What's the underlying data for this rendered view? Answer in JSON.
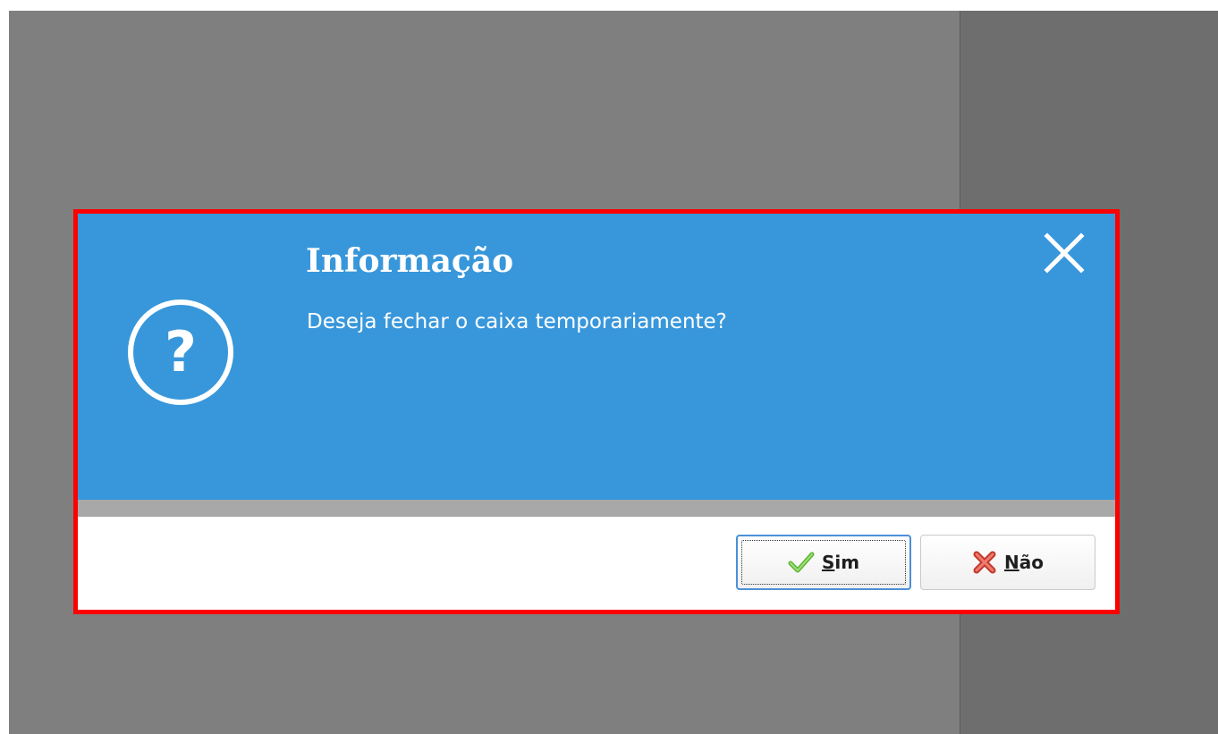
{
  "dialog": {
    "title": "Informação",
    "message": "Deseja fechar o caixa temporariamente?",
    "icon": "question-circle-icon",
    "close_icon": "close-icon",
    "header_color": "#3897db",
    "highlight_color": "#ff0000"
  },
  "buttons": {
    "yes": {
      "mnemonic": "S",
      "rest": "im",
      "icon": "checkmark-icon"
    },
    "no": {
      "mnemonic": "N",
      "rest": "ão",
      "icon": "red-x-icon"
    }
  }
}
